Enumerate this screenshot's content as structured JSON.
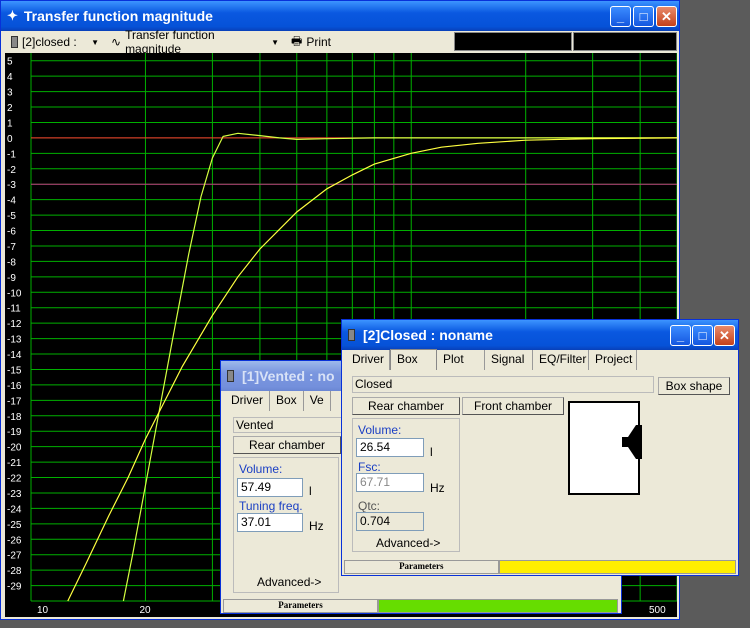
{
  "main_window": {
    "title": "Transfer function magnitude",
    "toolbar": {
      "project_select": "[2]closed :",
      "plot_select": "Transfer function magnitude",
      "print_label": "Print"
    }
  },
  "chart_data": {
    "type": "line",
    "title": "",
    "xlabel": "",
    "ylabel": "",
    "x_scale": "log",
    "xlim": [
      10,
      500
    ],
    "ylim": [
      -30,
      5.5
    ],
    "x_tick_labels": [
      "10",
      "20",
      "500"
    ],
    "y_tick_labels": [
      "5",
      "4",
      "3",
      "2",
      "1",
      "0",
      "-1",
      "-2",
      "-3",
      "-4",
      "-5",
      "-6",
      "-7",
      "-8",
      "-9",
      "-10",
      "-11",
      "-12",
      "-13",
      "-14",
      "-15",
      "-16",
      "-17",
      "-18",
      "-19",
      "-20",
      "-21",
      "-22",
      "-23",
      "-24",
      "-25",
      "-26",
      "-27",
      "-28",
      "-29"
    ],
    "reference_lines": [
      {
        "y": 0,
        "color": "#ff3030"
      },
      {
        "y": -3,
        "color": "#c03080"
      }
    ],
    "series": [
      {
        "color": "#d4ff40",
        "x": [
          17.5,
          18.5,
          20,
          22,
          24,
          26,
          28,
          30,
          32,
          35,
          40,
          45,
          50,
          60,
          80,
          120,
          200,
          500
        ],
        "y": [
          -30,
          -27,
          -22.5,
          -17,
          -12,
          -7.5,
          -3.8,
          -1.3,
          0.1,
          0.3,
          0.15,
          0,
          -0.1,
          -0.05,
          0,
          0,
          0,
          0
        ]
      },
      {
        "color": "#ffff40",
        "x": [
          12.5,
          14,
          16,
          18,
          20,
          22,
          25,
          30,
          35,
          40,
          50,
          60,
          70,
          80,
          100,
          120,
          150,
          200,
          300,
          500
        ],
        "y": [
          -30,
          -27.5,
          -24.5,
          -22,
          -19.5,
          -17.5,
          -14.8,
          -11.5,
          -9,
          -7.2,
          -4.8,
          -3.3,
          -2.4,
          -1.7,
          -1,
          -0.6,
          -0.35,
          -0.15,
          -0.05,
          0
        ]
      }
    ]
  },
  "vented_window": {
    "title": "[1]Vented : no",
    "tabs": [
      "Driver",
      "Box",
      "Ve"
    ],
    "selected_tab": "Box",
    "box_type": "Vented",
    "rear_chamber_label": "Rear chamber",
    "volume_label": "Volume:",
    "volume_value": "57.49",
    "volume_unit": "l",
    "tuning_label": "Tuning freq.",
    "tuning_value": "37.01",
    "tuning_unit": "Hz",
    "advanced_label": "Advanced->",
    "status_label": "Parameters",
    "status_color": "#66dd00"
  },
  "closed_window": {
    "title": "[2]Closed : noname",
    "tabs": [
      "Driver",
      "Box",
      "Plot",
      "Signal",
      "EQ/Filter",
      "Project"
    ],
    "selected_tab": "Box",
    "box_type": "Closed",
    "box_shape_label": "Box shape",
    "rear_chamber_label": "Rear chamber",
    "front_chamber_label": "Front chamber",
    "volume_label": "Volume:",
    "volume_value": "26.54",
    "volume_unit": "l",
    "fsc_label": "Fsc:",
    "fsc_value": "67.71",
    "fsc_unit": "Hz",
    "qtc_label": "Qtc:",
    "qtc_value": "0.704",
    "advanced_label": "Advanced->",
    "status_label": "Parameters",
    "status_color": "#ffee00"
  }
}
